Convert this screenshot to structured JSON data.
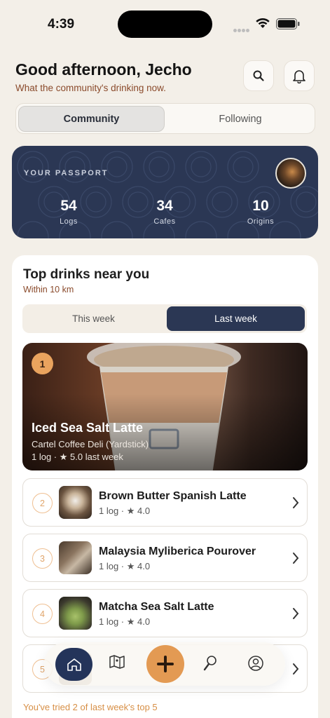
{
  "status_bar": {
    "time": "4:39"
  },
  "header": {
    "greeting": "Good afternoon, Jecho",
    "subtitle": "What the community's drinking now.",
    "icons": [
      "search-icon",
      "bell-icon"
    ]
  },
  "feed_tabs": [
    {
      "label": "Community",
      "selected": true
    },
    {
      "label": "Following",
      "selected": false
    }
  ],
  "passport": {
    "title": "YOUR PASSPORT",
    "stats": [
      {
        "value": "54",
        "label": "Logs"
      },
      {
        "value": "34",
        "label": "Cafes"
      },
      {
        "value": "10",
        "label": "Origins"
      }
    ]
  },
  "top_drinks": {
    "title": "Top drinks near you",
    "subtitle": "Within 10 km",
    "tabs": [
      {
        "label": "This week",
        "selected": false
      },
      {
        "label": "Last week",
        "selected": true
      }
    ],
    "featured": {
      "rank": "1",
      "name": "Iced Sea Salt Latte",
      "cafe": "Cartel Coffee Deli (Yardstick)",
      "meta": "1 log · ★ 5.0 last week"
    },
    "items": [
      {
        "rank": "2",
        "name": "Brown Butter Spanish Latte",
        "meta": "1 log · ★ 4.0"
      },
      {
        "rank": "3",
        "name": "Malaysia Myliberica Pourover",
        "meta": "1 log · ★ 4.0"
      },
      {
        "rank": "4",
        "name": "Matcha Sea Salt Latte",
        "meta": "1 log · ★ 4.0"
      },
      {
        "rank": "5",
        "name": "",
        "meta": ""
      }
    ],
    "footer_note": "You've tried 2 of last week's top 5"
  },
  "bottom_nav": {
    "items": [
      "home-icon",
      "map-icon",
      "add-icon",
      "discover-icon",
      "profile-icon"
    ],
    "active": "home-icon"
  },
  "colors": {
    "background": "#f3efe8",
    "navy": "#2b3754",
    "accent_orange": "#e39a53",
    "brown_text": "#8a4a2b"
  }
}
